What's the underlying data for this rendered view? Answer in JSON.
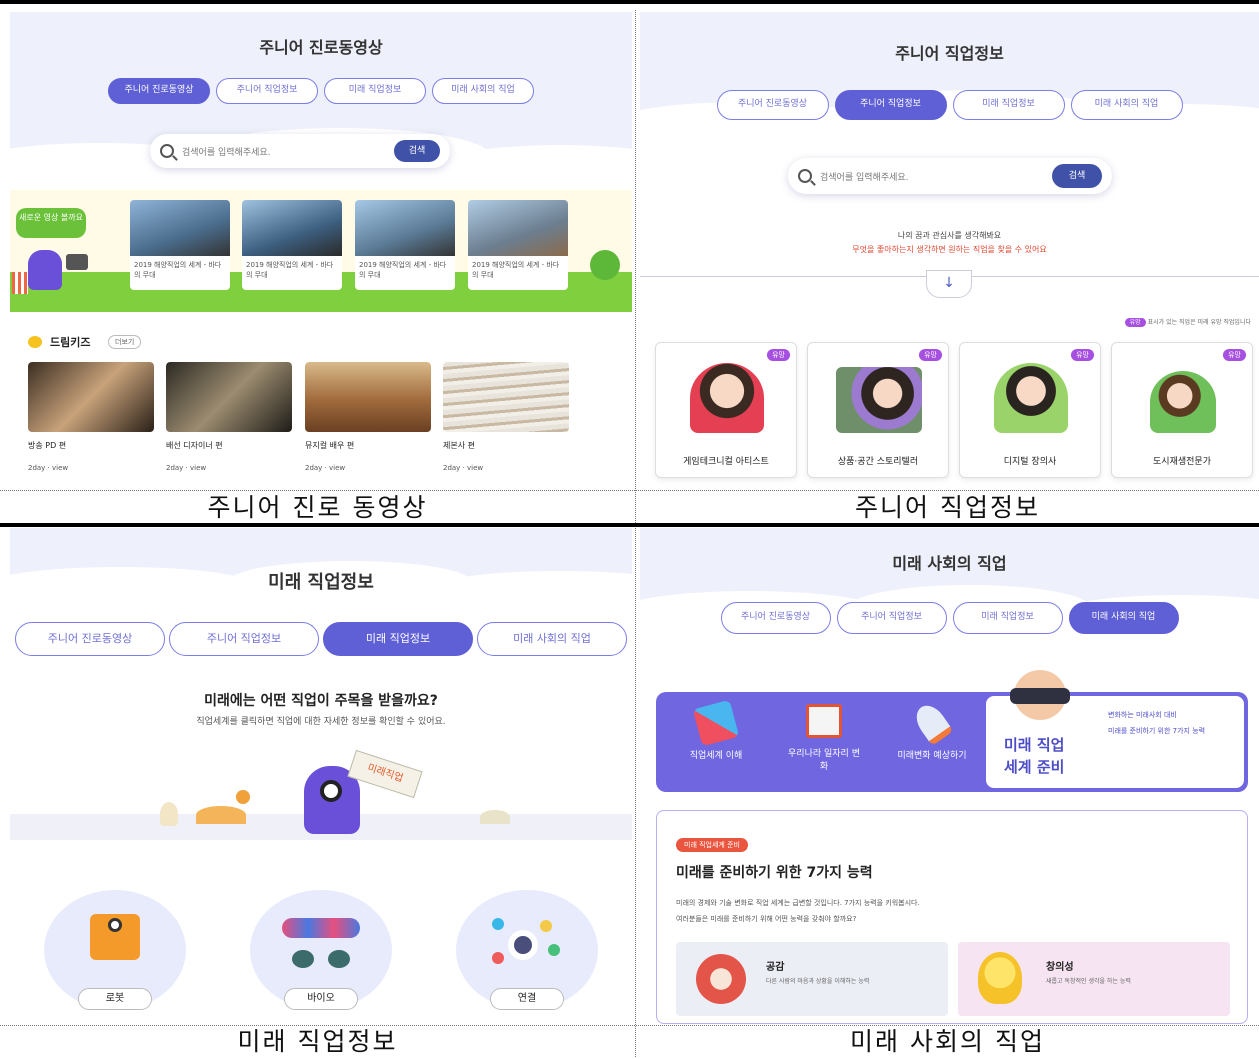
{
  "captions": {
    "junior_video": "주니어 진로 동영상",
    "junior_job": "주니어 직업정보",
    "future_job": "미래 직업정보",
    "future_society": "미래 사회의 직업"
  },
  "tabs": [
    "주니어 진로동영상",
    "주니어 직업정보",
    "미래 직업정보",
    "미래 사회의 직업"
  ],
  "panel1": {
    "title": "주니어 진로동영상",
    "search_placeholder": "검색어를 입력해주세요.",
    "search_button": "검색",
    "promo_label": "새로운 영상 볼까요",
    "featured_captions": [
      "2019 해양직업의 세계 - 바다의 무대",
      "2019 해양직업의 세계 - 바다의 무대",
      "2019 해양직업의 세계 - 바다의 무대",
      "2019 해양직업의 세계 - 바다의 무대"
    ],
    "section_title": "드림키즈",
    "section_more": "더보기",
    "videos": [
      {
        "title": "방송 PD 편",
        "sub": "2day · view"
      },
      {
        "title": "배선 디자이너 편",
        "sub": "2day · view"
      },
      {
        "title": "뮤지컬 배우 편",
        "sub": "2day · view"
      },
      {
        "title": "제본사 편",
        "sub": "2day · view"
      }
    ]
  },
  "panel2": {
    "title": "주니어 직업정보",
    "search_placeholder": "검색어를 입력해주세요.",
    "search_button": "검색",
    "intro_line1": "나의 꿈과 관심사를 생각해봐요",
    "intro_line2": "무엇을 좋아하는지 생각하면 원하는 직업을 찾을 수 있어요",
    "legend_note": "표시가 있는 직업은 미래 유망 직업입니다",
    "badge_label": "유망",
    "jobs": [
      "게임테크니컬 아티스트",
      "상품·공간 스토리텔러",
      "디지털 장의사",
      "도시재생전문가"
    ]
  },
  "panel3": {
    "title": "미래 직업정보",
    "question": "미래에는 어떤 직업이 주목을 받을까요?",
    "desc": "직업세계를 클릭하면 직업에 대한 자세한 정보를 확인할 수 있어요.",
    "sign": "미래직업",
    "categories": [
      "로봇",
      "바이오",
      "연결"
    ]
  },
  "panel4": {
    "title": "미래 사회의 직업",
    "menu": [
      "직업세계 이해",
      "우리나라 일자리 변화",
      "미래변화 예상하기"
    ],
    "feature_title_line1": "미래 직업",
    "feature_title_line2": "세계 준비",
    "feature_bullets": [
      "변화하는 미래사회 대비",
      "미래를 준비하기 위한 7가지 능력"
    ],
    "tag": "미래 직업세계 준비",
    "heading": "미래를 준비하기 위한 7가지 능력",
    "body1": "미래의 경제와 기술 변화로 직업 세계는 급변할 것입니다. 7가지 능력을 키워봅시다.",
    "body2": "여러분들은 미래를 준비하기 위해 어떤 능력을 갖춰야 할까요?",
    "abilities": [
      {
        "name": "공감",
        "desc": "다른 사람의 마음과 상황을 이해하는 능력"
      },
      {
        "name": "창의성",
        "desc": "새롭고 독창적인 생각을 하는 능력"
      }
    ]
  }
}
